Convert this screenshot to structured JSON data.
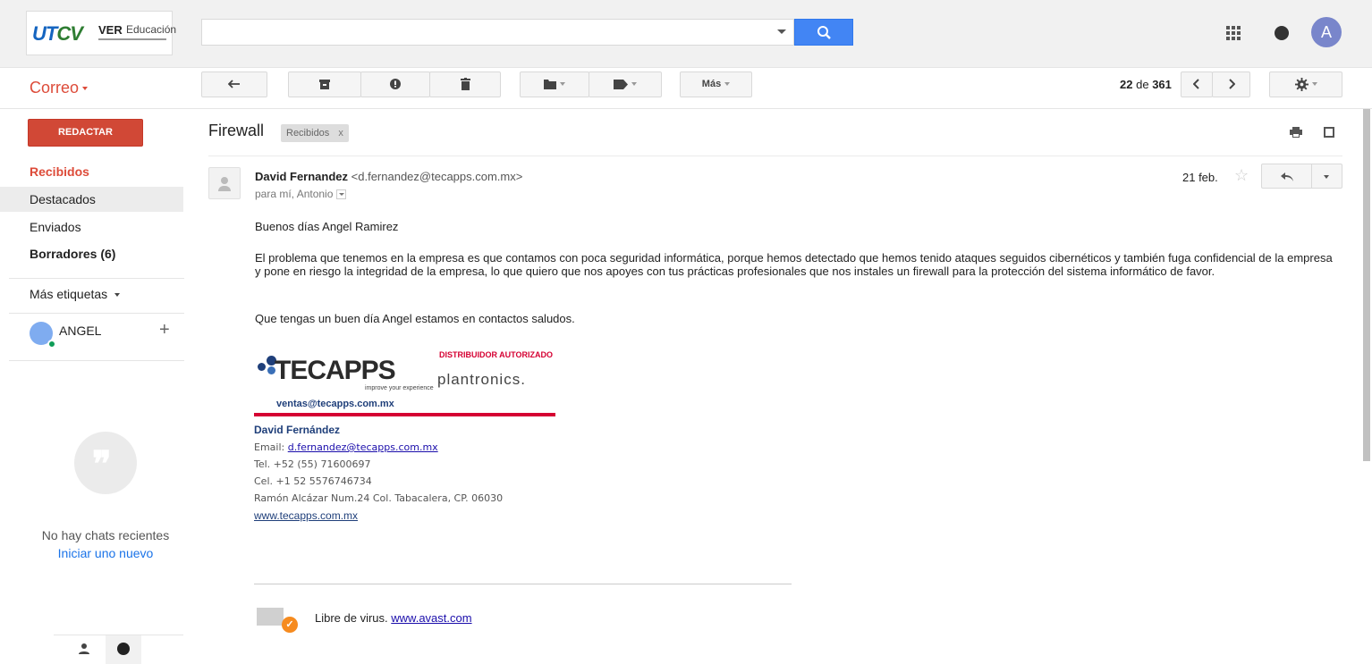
{
  "header": {
    "logo_text_1": "UTCV",
    "logo_text_ver": "VER",
    "logo_text_edu": "Educación",
    "search_placeholder": "",
    "avatar_letter": "A"
  },
  "toolbar": {
    "app_title": "Correo",
    "more_label": "Más",
    "page_current": "22",
    "page_of": "de",
    "page_total": "361"
  },
  "sidebar": {
    "compose_label": "REDACTAR",
    "items": [
      {
        "label": "Recibidos"
      },
      {
        "label": "Destacados"
      },
      {
        "label": "Enviados"
      },
      {
        "label": "Borradores (6)"
      }
    ],
    "more_labels": "Más etiquetas",
    "user_name": "ANGEL",
    "no_chats": "No hay chats recientes",
    "start_chat": "Iniciar uno nuevo"
  },
  "email": {
    "subject": "Firewall",
    "label": "Recibidos",
    "label_close": "x",
    "sender_name": "David Fernandez",
    "sender_email": "<d.fernandez@tecapps.com.mx>",
    "recipients": "para mí, Antonio",
    "date": "21 feb.",
    "greeting": "Buenos días Angel Ramirez",
    "paragraph": "El problema que tenemos en la empresa es que contamos con poca seguridad informática, porque hemos detectado que hemos tenido ataques seguidos cibernéticos y también fuga confidencial de la empresa y pone en riesgo la integridad de la empresa, lo que quiero que nos apoyes con tus prácticas profesionales que nos instales un firewall para la protección del sistema informático de favor.",
    "closing": "Que tengas un buen día Angel estamos en contactos saludos."
  },
  "signature": {
    "brand": "TECAPPS",
    "tagline": "improve your experience",
    "distributor": "DISTRIBUIDOR AUTORIZADO",
    "partner": "plantronics.",
    "ventas": "ventas@tecapps.com.mx",
    "name": "David Fernández",
    "email_label": "Email: ",
    "email": "d.fernandez@tecapps.com.mx",
    "tel": "Tel. +52 (55) 71600697",
    "cel": "Cel. +1 52 5576746734",
    "address": "Ramón Alcázar Num.24  Col. Tabacalera, CP. 06030",
    "website": "www.tecapps.com.mx"
  },
  "footer": {
    "virus_text": "Libre de virus. ",
    "virus_link": "www.avast.com"
  },
  "colors": {
    "accent_red": "#dd4b39",
    "search_blue": "#4285f4",
    "brand_red": "#d50032"
  }
}
